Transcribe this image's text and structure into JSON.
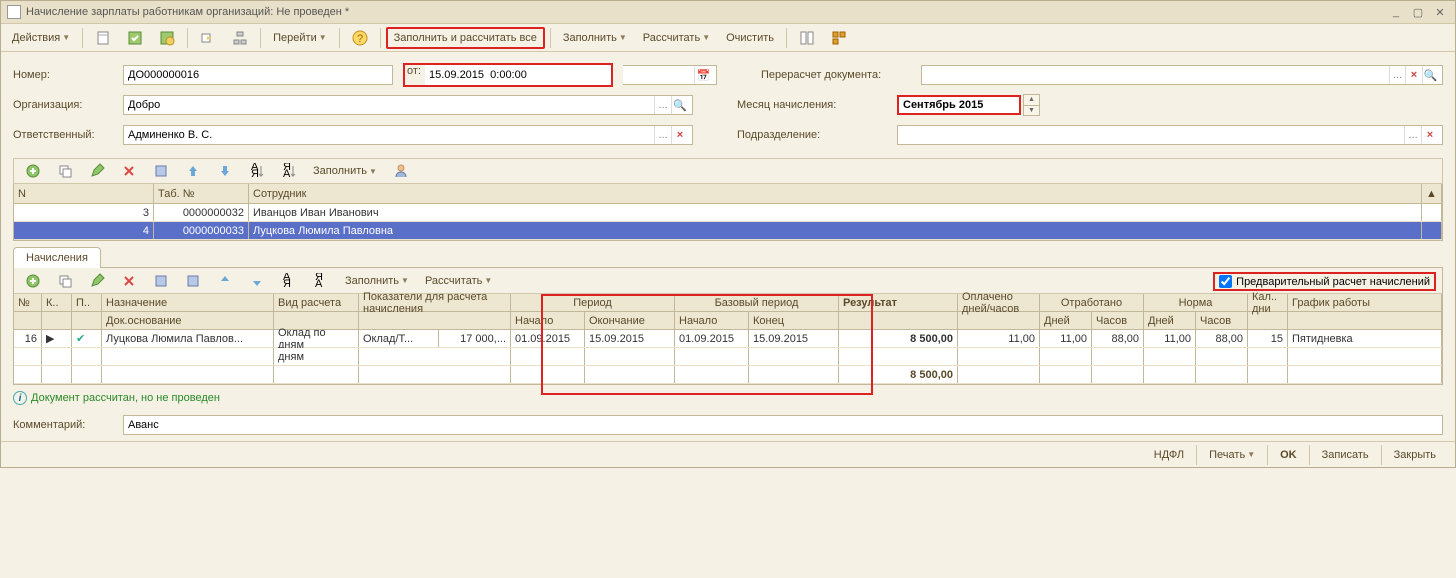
{
  "window": {
    "title": "Начисление зарплаты работникам организаций: Не проведен *",
    "minimize": "_",
    "restore": "▢",
    "close": "✕"
  },
  "toolbar": {
    "actions": "Действия",
    "goto": "Перейти",
    "fill_calc_all": "Заполнить и рассчитать все",
    "fill": "Заполнить",
    "calc": "Рассчитать",
    "clear": "Очистить"
  },
  "form": {
    "number_lbl": "Номер:",
    "number_val": "ДО000000016",
    "date_lbl": "от:",
    "date_val": "15.09.2015  0:00:00",
    "org_lbl": "Организация:",
    "org_val": "Добро",
    "resp_lbl": "Ответственный:",
    "resp_val": "Админенко В. С.",
    "recalc_lbl": "Перерасчет документа:",
    "recalc_val": "",
    "month_lbl": "Месяц начисления:",
    "month_val": "Сентябрь 2015",
    "dept_lbl": "Подразделение:",
    "dept_val": ""
  },
  "emp_head": {
    "n": "N",
    "tab": "Таб. №",
    "emp": "Сотрудник"
  },
  "employees": [
    {
      "n": "3",
      "tab": "0000000032",
      "name": "Иванцов Иван Иванович",
      "sel": false
    },
    {
      "n": "4",
      "tab": "0000000033",
      "name": "Луцкова Люмила Павловна",
      "sel": true
    }
  ],
  "tabs": {
    "accruals": "Начисления"
  },
  "precalc_lbl": "Предварительный расчет начислений",
  "calc_head": {
    "n": "№",
    "k": "К..",
    "p": "П..",
    "naz": "Назначение",
    "docbase": "Док.основание",
    "vid": "Вид расчета",
    "pokaz": "Показатели для расчета начисления",
    "period": "Период",
    "bperiod": "Базовый период",
    "nach": "Начало",
    "okon": "Окончание",
    "bnach": "Начало",
    "bkon": "Конец",
    "result": "Результат",
    "opl": "Оплачено дней/часов",
    "otr": "Отработано",
    "norm": "Норма",
    "kal": "Кал.. дни",
    "graf": "График работы",
    "dney": "Дней",
    "chas": "Часов"
  },
  "calc_rows": [
    {
      "n": "16",
      "naz": "Луцкова Люмила Павлов...",
      "vid": "Оклад по дням",
      "pokaz": "Оклад/Т...",
      "pokaz_sum": "17 000,...",
      "pnach": "01.09.2015",
      "pokon": "15.09.2015",
      "bnach": "01.09.2015",
      "bkon": "15.09.2015",
      "result": "8 500,00",
      "opl": "11,00",
      "otr_d": "11,00",
      "otr_c": "88,00",
      "norm_d": "11,00",
      "norm_c": "88,00",
      "kal": "15",
      "graf": "Пятидневка"
    }
  ],
  "calc_total": "8 500,00",
  "status": "Документ рассчитан, но не проведен",
  "comment_lbl": "Комментарий:",
  "comment_val": "Аванс",
  "footer": {
    "ndfl": "НДФЛ",
    "print": "Печать",
    "ok": "OK",
    "save": "Записать",
    "close": "Закрыть"
  },
  "sub": {
    "fill": "Заполнить",
    "calc": "Рассчитать"
  }
}
